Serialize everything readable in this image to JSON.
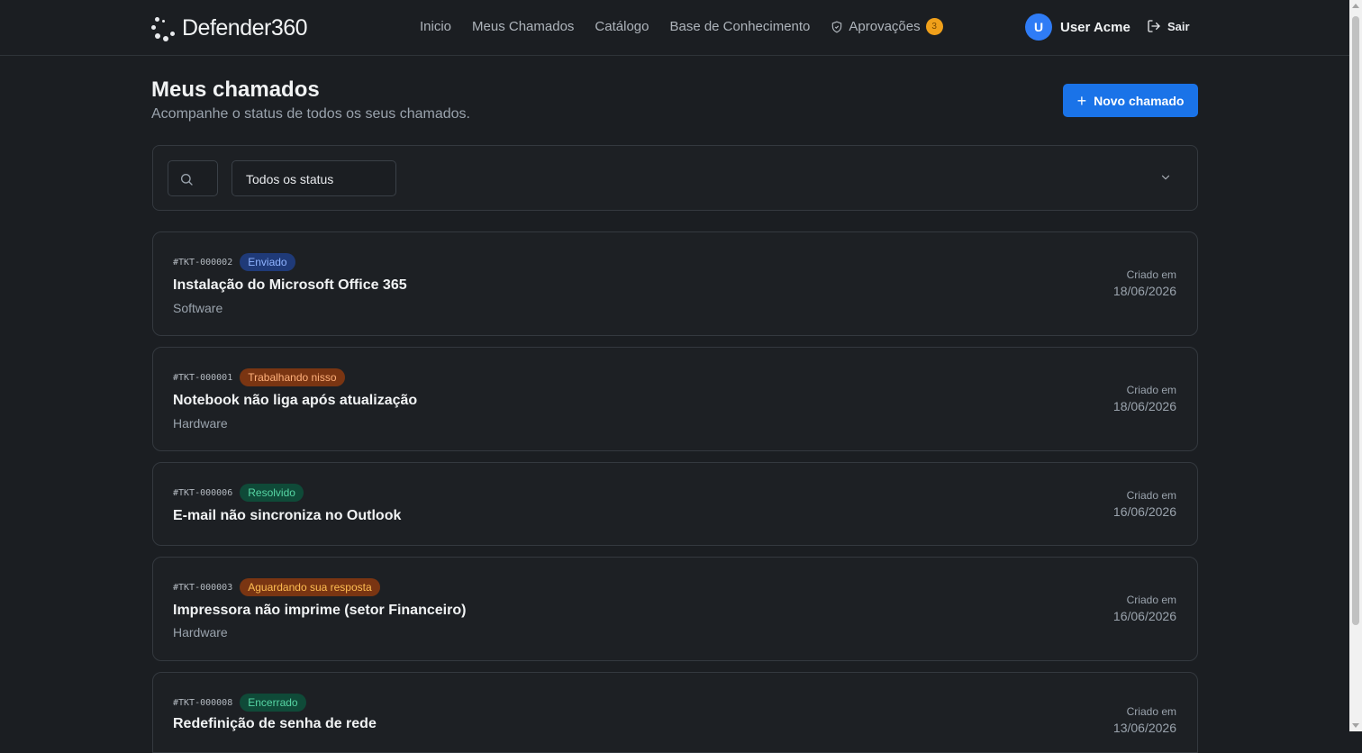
{
  "header": {
    "logo_text": "Defender360",
    "nav": {
      "inicio": "Inicio",
      "meus_chamados": "Meus Chamados",
      "catalogo": "Catálogo",
      "base_conhecimento": "Base de Conhecimento",
      "aprovacoes": "Aprovações",
      "aprovacoes_count": "3"
    },
    "user": {
      "initial": "U",
      "name": "User Acme"
    },
    "logout_label": "Sair"
  },
  "page": {
    "title": "Meus chamados",
    "subtitle": "Acompanhe o status de todos os seus chamados.",
    "new_button": "Novo chamado"
  },
  "filters": {
    "status_selected": "Todos os status"
  },
  "tickets": [
    {
      "id": "#TKT-000002",
      "status": "Enviado",
      "title": "Instalação do Microsoft Office 365",
      "category": "Software",
      "created_label": "Criado em",
      "created_date": "18/06/2026"
    },
    {
      "id": "#TKT-000001",
      "status": "Trabalhando nisso",
      "title": "Notebook não liga após atualização",
      "category": "Hardware",
      "created_label": "Criado em",
      "created_date": "18/06/2026"
    },
    {
      "id": "#TKT-000006",
      "status": "Resolvido",
      "title": "E-mail não sincroniza no Outlook",
      "category": "",
      "created_label": "Criado em",
      "created_date": "16/06/2026"
    },
    {
      "id": "#TKT-000003",
      "status": "Aguardando sua resposta",
      "title": "Impressora não imprime (setor Financeiro)",
      "category": "Hardware",
      "created_label": "Criado em",
      "created_date": "16/06/2026"
    },
    {
      "id": "#TKT-000008",
      "status": "Encerrado",
      "title": "Redefinição de senha de rede",
      "category": "",
      "created_label": "Criado em",
      "created_date": "13/06/2026"
    }
  ],
  "colors": {
    "accent": "#1a73e8",
    "background": "#1b1e22",
    "approvals_badge": "#f0a01a"
  }
}
